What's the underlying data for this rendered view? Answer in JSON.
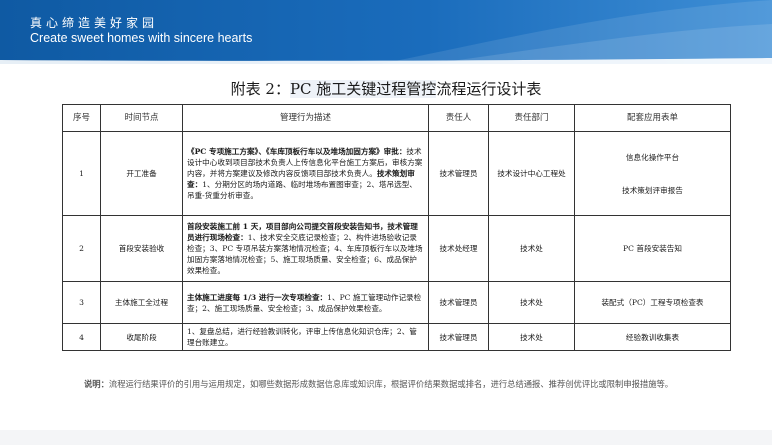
{
  "banner": {
    "cn": "真心缔造美好家园",
    "en": "Create sweet homes with sincere hearts"
  },
  "title": {
    "prefix": "附表 2：",
    "highlight": "PC 施工关键过程管控",
    "suffix": "流程运行设计表"
  },
  "table": {
    "headers": [
      "序号",
      "时间节点",
      "管理行为描述",
      "责任人",
      "责任部门",
      "配套应用表单"
    ],
    "rows": [
      {
        "no": "1",
        "node": "开工准备",
        "desc": [
          {
            "text": "《PC 专项施工方案》、《车库顶板行车以及堆场加固方案》",
            "bold": true
          },
          {
            "text": "审批：",
            "bold": true
          },
          {
            "text": "技术设计中心收到项目部技术负责人上传信息化平台施工方案后，审核方案内容，并将方案建议及修改内容反馈项目部技术负责人。",
            "bold": false
          },
          {
            "text": "技术策划审查：",
            "bold": true
          },
          {
            "text": "1、分期分区的场内道路、临时堆场布置图审查；2、塔吊选型、吊重-货重分析审查。",
            "bold": false
          }
        ],
        "person": "技术管理员",
        "dept": "技术设计中心工程处",
        "forms": [
          "信息化操作平台",
          "技术策划评审报告"
        ]
      },
      {
        "no": "2",
        "node": "首段安装验收",
        "desc": [
          {
            "text": "首段安装施工前 1 天，项目部向公司提交首段安装告知书，技术管理员进行现场检查：",
            "bold": true
          },
          {
            "text": "1、技术安全交底记录检查；2、构件进场验收记录检查；3、PC 专项吊装方案落地情况检查；4、车库顶板行车以及堆场加固方案落地情况检查；5、施工现场质量、安全检查；6、成品保护效果检查。",
            "bold": false
          }
        ],
        "person": "技术处经理",
        "dept": "技术处",
        "forms": [
          "PC 首段安装告知"
        ]
      },
      {
        "no": "3",
        "node": "主体施工全过程",
        "desc": [
          {
            "text": "主体施工进度每 1/3 进行一次专项检查：",
            "bold": true
          },
          {
            "text": "1、PC 施工管理动作记录检查；2、施工现场质量、安全检查；3、成品保护效果检查。",
            "bold": false
          }
        ],
        "person": "技术管理员",
        "dept": "技术处",
        "forms": [
          "装配式（PC）工程专项检查表"
        ]
      },
      {
        "no": "4",
        "node": "收尾阶段",
        "desc": [
          {
            "text": "1、复盘总结，进行经验教训转化，评审上传信息化知识仓库；2、管理台账建立。",
            "bold": false
          }
        ],
        "person": "技术管理员",
        "dept": "技术处",
        "forms": [
          "经验教训收集表"
        ]
      }
    ]
  },
  "note": {
    "label": "说明：",
    "text": "流程运行结果评价的引用与运用规定，如哪些数据形成数据信息库或知识库，根据评价结果数据或排名，进行总结通报、推荐创优评比或限制申报措施等。"
  }
}
